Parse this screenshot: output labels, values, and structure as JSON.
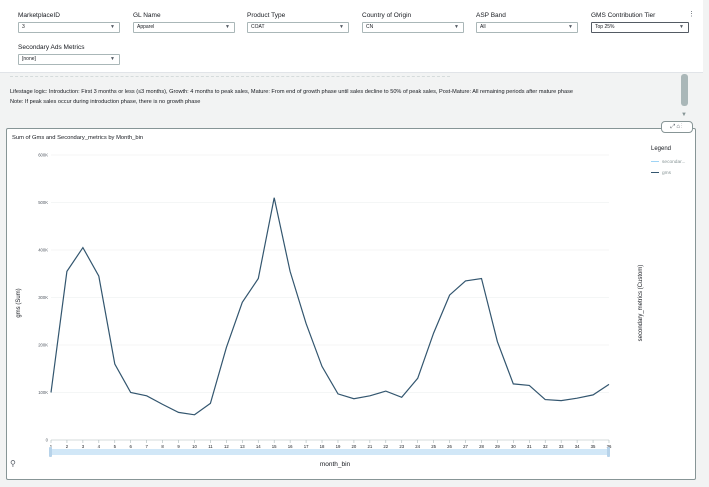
{
  "filters": [
    {
      "label": "MarketplaceID",
      "value": "3"
    },
    {
      "label": "GL Name",
      "value": "Apparel"
    },
    {
      "label": "Product Type",
      "value": "COAT"
    },
    {
      "label": "Country of Origin",
      "value": "CN"
    },
    {
      "label": "ASP Band",
      "value": "All"
    },
    {
      "label": "GMS Contribution Tier",
      "value": "Top 25%"
    },
    {
      "label": "Secondary Ads Metrics",
      "value": "[none]"
    }
  ],
  "note": {
    "line1": "Lifestage logic: Introduction: First 3 months or less (≤3 months), Growth: 4 months to peak sales, Mature: From end of growth phase until sales decline to 50% of peak sales, Post-Mature: All remaining periods after mature phase",
    "line2": "Note: If peak sales occur during introduction phase, there is no growth phase"
  },
  "visual": {
    "legend_title": "Legend",
    "legend": [
      {
        "name": "secondar...",
        "color": "#9fd4f5"
      },
      {
        "name": "gms",
        "color": "#33566f"
      }
    ],
    "line_color": "#33566f"
  },
  "icons": {
    "chevron": "chevron-down-icon",
    "more": "more-vertical-icon",
    "expand": "expand-icon",
    "zoom": "zoom-icon"
  },
  "chart_data": {
    "type": "line",
    "title": "Sum of Gms and Secondary_metrics by Month_bin",
    "xlabel": "month_bin",
    "ylabel": "gms (Sum)",
    "ylabel2": "secondary_metrics (Custom)",
    "x": [
      1,
      2,
      3,
      4,
      5,
      6,
      7,
      8,
      9,
      10,
      11,
      12,
      13,
      14,
      15,
      16,
      17,
      18,
      19,
      20,
      21,
      22,
      23,
      24,
      25,
      26,
      27,
      28,
      29,
      30,
      31,
      32,
      33,
      34,
      35,
      36
    ],
    "yticks": [
      "0",
      "100K",
      "200K",
      "300K",
      "400K",
      "500K",
      "600K"
    ],
    "ylim": [
      0,
      600000
    ],
    "series": [
      {
        "name": "gms",
        "values": [
          100000,
          355000,
          405000,
          345000,
          160000,
          100000,
          93000,
          75000,
          58000,
          53000,
          77000,
          195000,
          290000,
          340000,
          510000,
          355000,
          245000,
          155000,
          97000,
          87000,
          93000,
          103000,
          90000,
          130000,
          225000,
          305000,
          335000,
          340000,
          207000,
          118000,
          115000,
          85000,
          83000,
          88000,
          95000,
          117000
        ]
      },
      {
        "name": "secondar...",
        "values": []
      }
    ],
    "grid": true,
    "legend_position": "right"
  }
}
